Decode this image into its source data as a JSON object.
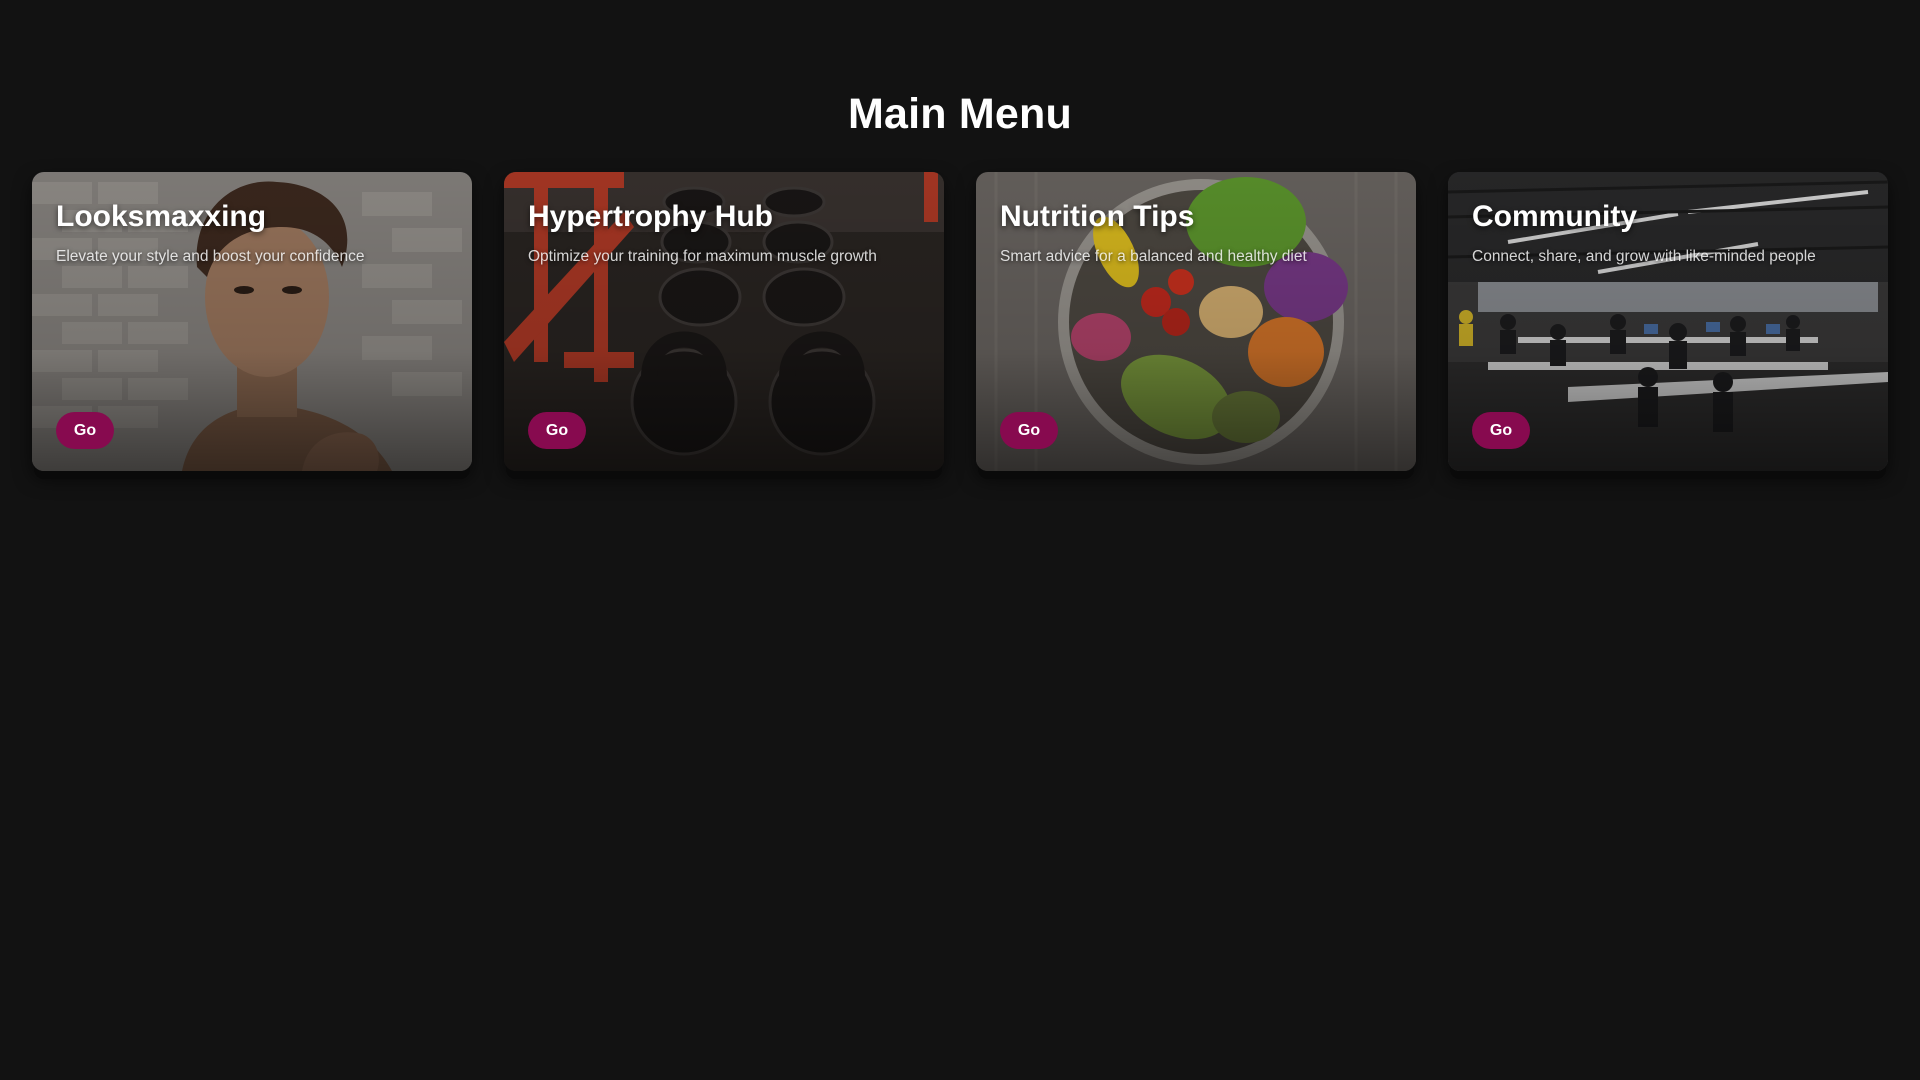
{
  "page": {
    "title": "Main Menu"
  },
  "colors": {
    "background": "#121212",
    "accent": "#870a4f",
    "text": "#ffffff"
  },
  "cards": [
    {
      "title": "Looksmaxxing",
      "description": "Elevate your style and boost your confidence",
      "button_label": "Go",
      "image": "portrait-photo"
    },
    {
      "title": "Hypertrophy Hub",
      "description": "Optimize your training for maximum muscle growth",
      "button_label": "Go",
      "image": "kettlebells-photo"
    },
    {
      "title": "Nutrition Tips",
      "description": "Smart advice for a balanced and healthy diet",
      "button_label": "Go",
      "image": "salad-bowl-photo"
    },
    {
      "title": "Community",
      "description": "Connect, share, and grow with like-minded people",
      "button_label": "Go",
      "image": "open-office-photo"
    }
  ]
}
